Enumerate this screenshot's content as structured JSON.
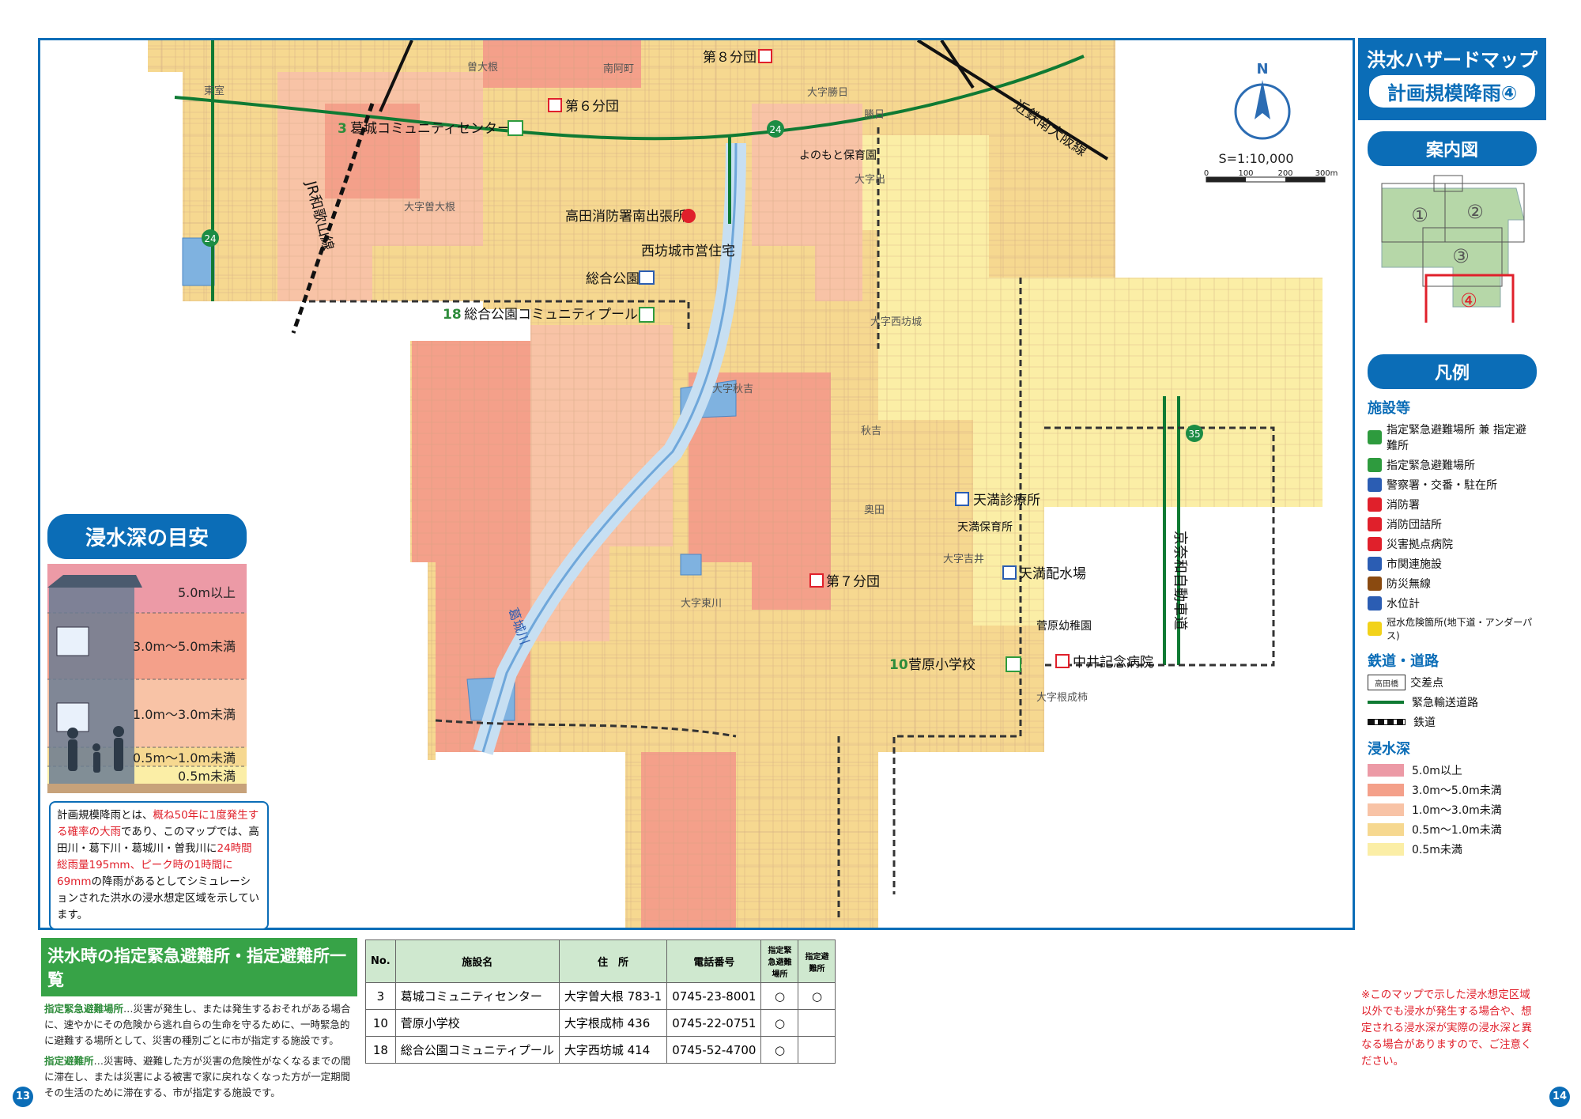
{
  "title": {
    "line1": "洪水ハザードマップ",
    "line2": "計画規模降雨④"
  },
  "index_map": {
    "heading": "案内図",
    "sections": [
      "①",
      "②",
      "③",
      "④"
    ]
  },
  "scale": {
    "label": "S=1:10,000",
    "ticks": [
      "0",
      "100",
      "200",
      "300m"
    ],
    "north": "N"
  },
  "legend": {
    "heading": "凡例",
    "facilities_heading": "施設等",
    "facilities": [
      {
        "icon": "shelter-both-icon",
        "color": "#2e9b3e",
        "label": "指定緊急避難場所 兼 指定避難所"
      },
      {
        "icon": "emergency-shelter-icon",
        "color": "#2e9b3e",
        "label": "指定緊急避難場所"
      },
      {
        "icon": "police-icon",
        "color": "#2b5db3",
        "label": "警察署・交番・駐在所"
      },
      {
        "icon": "fire-station-icon",
        "color": "#e0202b",
        "label": "消防署"
      },
      {
        "icon": "fire-brigade-icon",
        "color": "#e0202b",
        "label": "消防団詰所"
      },
      {
        "icon": "hospital-icon",
        "color": "#e0202b",
        "label": "災害拠点病院"
      },
      {
        "icon": "city-facility-icon",
        "color": "#2b5db3",
        "label": "市関連施設"
      },
      {
        "icon": "radio-icon",
        "color": "#8a4a10",
        "label": "防災無線"
      },
      {
        "icon": "water-gauge-icon",
        "color": "#2b5db3",
        "label": "水位計"
      },
      {
        "icon": "flood-danger-icon",
        "color": "#f2d21a",
        "label": "冠水危険箇所(地下道・アンダーパス)"
      }
    ],
    "roads_heading": "鉄道・道路",
    "roads": [
      {
        "icon": "intersection-icon",
        "label": "交差点",
        "sample": "高田橋"
      },
      {
        "icon": "emergency-road-icon",
        "label": "緊急輸送道路"
      },
      {
        "icon": "railway-icon",
        "label": "鉄道"
      }
    ],
    "depth_heading": "浸水深",
    "depths": [
      {
        "label": "5.0m以上",
        "color": "#ec9aa6"
      },
      {
        "label": "3.0m〜5.0m未満",
        "color": "#f4a08a"
      },
      {
        "label": "1.0m〜3.0m未満",
        "color": "#f8c3a6"
      },
      {
        "label": "0.5m〜1.0m未満",
        "color": "#f6d890"
      },
      {
        "label": "0.5m未満",
        "color": "#fbeea6"
      }
    ]
  },
  "depth_guide": {
    "title": "浸水深の目安",
    "levels": [
      "5.0m以上",
      "3.0m〜5.0m未満",
      "1.0m〜3.0m未満",
      "0.5m〜1.0m未満",
      "0.5m未満"
    ]
  },
  "note": {
    "p1": "計画規模降雨とは、",
    "r1": "概ね50年に1度発生する確率の大雨",
    "p2": "であり、このマップでは、高田川・葛下川・葛城川・曽我川に",
    "r2": "24時間総雨量195mm、ピーク時の1時間に69mm",
    "p3": "の降雨があるとしてシミュレーションされた洪水の浸水想定区域を示しています。"
  },
  "map_labels": {
    "places": [
      "曽大根",
      "南阿町",
      "大字勝日",
      "大字曽大根",
      "大字出",
      "大字西坊城",
      "大字秋吉",
      "大字吉井",
      "大字東川",
      "大字根成柿",
      "秋吉",
      "奥田",
      "勝日",
      "東室"
    ],
    "facilities": [
      {
        "name": "第８分団"
      },
      {
        "name": "第６分団"
      },
      {
        "num": "3",
        "name": "葛城コミュニティセンター"
      },
      {
        "name": "よのもと保育園"
      },
      {
        "name": "高田消防署南出張所"
      },
      {
        "name": "西坊城市営住宅"
      },
      {
        "name": "総合公園"
      },
      {
        "num": "18",
        "name": "総合公園コミュニティプール"
      },
      {
        "name": "天満診療所"
      },
      {
        "name": "天満保育所"
      },
      {
        "name": "第７分団"
      },
      {
        "name": "天満配水場"
      },
      {
        "name": "菅原幼稚園"
      },
      {
        "num": "10",
        "name": "菅原小学校"
      },
      {
        "name": "中井記念病院"
      }
    ],
    "lines": [
      "近鉄南大阪線",
      "JR和歌山線",
      "京奈和自動車道",
      "葛城川"
    ],
    "route_markers": [
      "24",
      "24",
      "35"
    ]
  },
  "shelter_section": {
    "heading": "洪水時の指定緊急避難所・指定避難所一覧",
    "def1_term": "指定緊急避難場所",
    "def1_text": "…災害が発生し、または発生するおそれがある場合に、速やかにその危険から逃れ自らの生命を守るために、一時緊急的に避難する場所として、災害の種別ごとに市が指定する施設です。",
    "def2_term": "指定避難所",
    "def2_text": "…災害時、避難した方が災害の危険性がなくなるまでの間に滞在し、または災害による被害で家に戻れなくなった方が一定期間その生活のために滞在する、市が指定する施設です。",
    "columns": [
      "No.",
      "施設名",
      "住　所",
      "電話番号",
      "指定緊急避難場所",
      "指定避難所"
    ],
    "rows": [
      [
        "3",
        "葛城コミュニティセンター",
        "大字曽大根 783-1",
        "0745-23-8001",
        "○",
        "○"
      ],
      [
        "10",
        "菅原小学校",
        "大字根成柿 436",
        "0745-22-0751",
        "○",
        ""
      ],
      [
        "18",
        "総合公園コミュニティプール",
        "大字西坊城 414",
        "0745-52-4700",
        "○",
        ""
      ]
    ]
  },
  "caution": "※このマップで示した浸水想定区域以外でも浸水が発生する場合や、想定される浸水深が実際の浸水深と異なる場合がありますので、ご注意ください。",
  "page_numbers": {
    "left": "13",
    "right": "14"
  }
}
